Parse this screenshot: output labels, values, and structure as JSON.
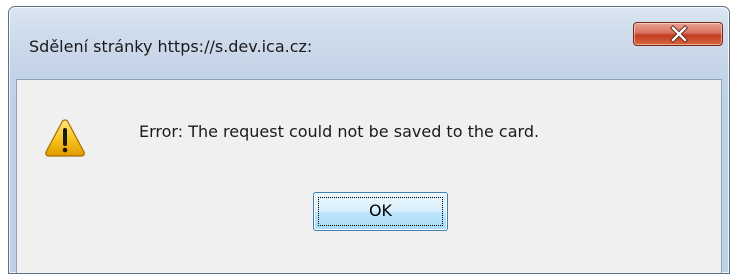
{
  "dialog": {
    "title": "Sdělení stránky https://s.dev.ica.cz:",
    "message": "Error: The request could not be saved to the card.",
    "ok_label": "OK",
    "icon": "warning-icon",
    "close_icon": "close-icon",
    "colors": {
      "close_button": "#c9432a",
      "ok_button_border": "#3c7fb1",
      "warning_fill": "#f7c21b"
    }
  }
}
